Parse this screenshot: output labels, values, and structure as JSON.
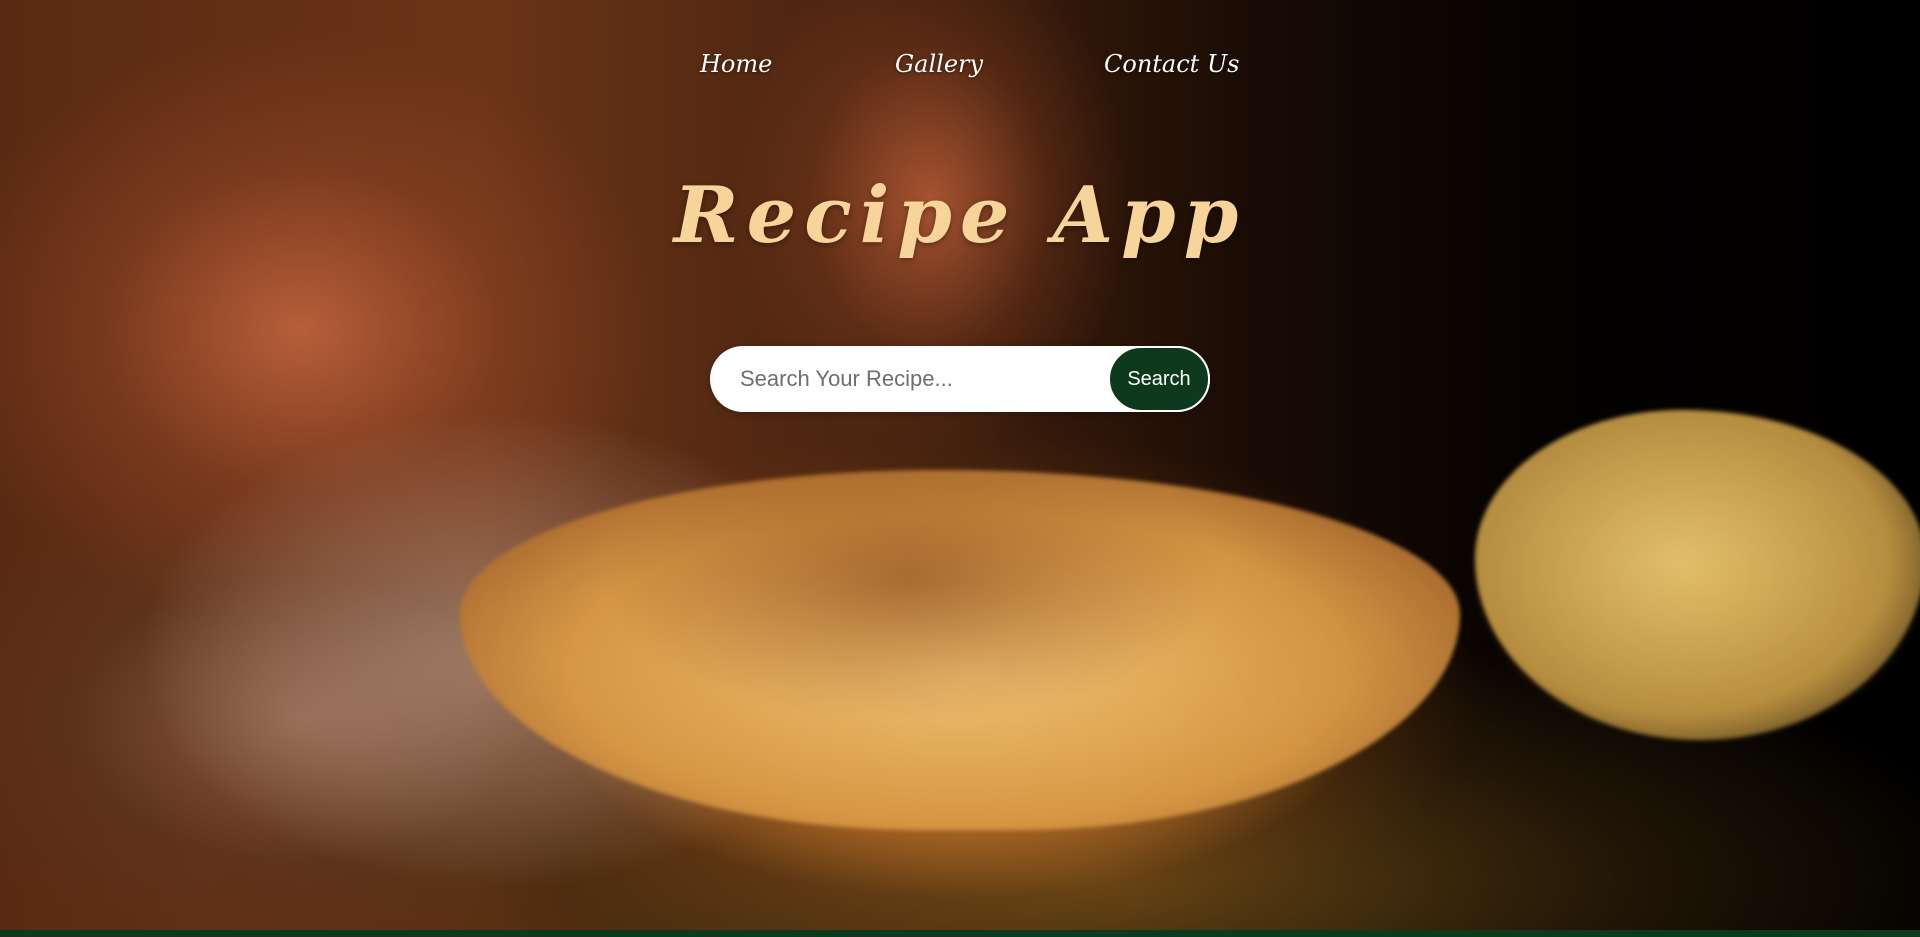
{
  "nav": {
    "items": [
      {
        "label": "Home"
      },
      {
        "label": "Gallery"
      },
      {
        "label": "Contact Us"
      }
    ]
  },
  "hero": {
    "title": "Recipe App",
    "background": "steaming flatbread on griddle photo"
  },
  "search": {
    "placeholder": "Search Your Recipe...",
    "value": "",
    "button_label": "Search"
  },
  "colors": {
    "title": "#f6d49a",
    "accent": "#0d3a1c",
    "nav_text": "#ffffff"
  }
}
